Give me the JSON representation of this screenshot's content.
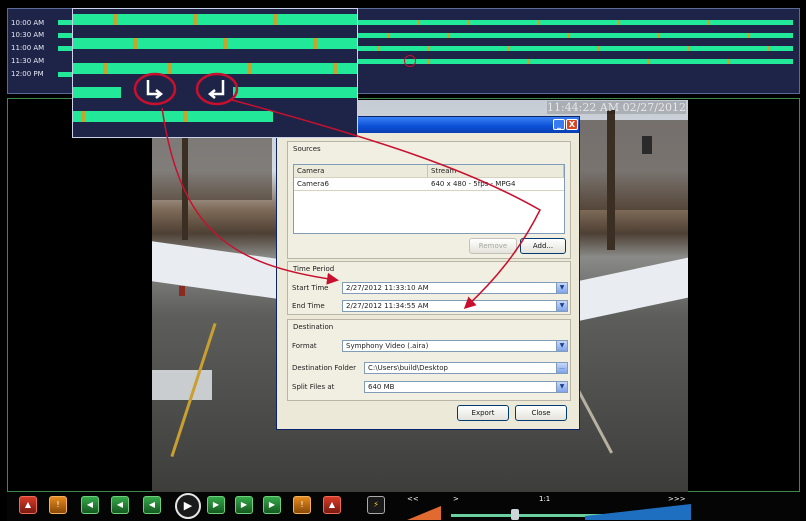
{
  "timeline": {
    "labels": [
      "10:00 AM",
      "10:30 AM",
      "11:00 AM",
      "11:30 AM",
      "12:00 PM"
    ]
  },
  "video": {
    "timestamp": "11:44:22 AM 02/27/2012"
  },
  "dialog": {
    "titlebar_buttons": {
      "minimize": "_",
      "close": "X"
    },
    "sources": {
      "group_label": "Sources",
      "columns": [
        "Camera",
        "Stream"
      ],
      "rows": [
        {
          "camera": "Camera6",
          "stream": "640 x 480 - 5fps - MPG4"
        }
      ],
      "remove_label": "Remove",
      "add_label": "Add..."
    },
    "time_period": {
      "group_label": "Time Period",
      "start_label": "Start Time",
      "start_value": "2/27/2012 11:33:10 AM",
      "end_label": "End Time",
      "end_value": "2/27/2012 11:34:55 AM"
    },
    "destination": {
      "group_label": "Destination",
      "format_label": "Format",
      "format_value": "Symphony Video (.aira)",
      "folder_label": "Destination Folder",
      "folder_value": "C:\\Users\\build\\Desktop",
      "browse_label": "...",
      "split_label": "Split Files at",
      "split_value": "640 MB"
    },
    "export_label": "Export",
    "close_label": "Close"
  },
  "controls": {
    "speed_labels": {
      "slow": "<<",
      "reverse": ">",
      "normal": "1:1",
      "fast": ">>>"
    }
  },
  "colors": {
    "timeline_bg": "#1e2448",
    "recording_green": "#22e89a",
    "motion_orange": "#c9a42a",
    "annotation_red": "#c8102e",
    "xp_title_blue": "#0a4fd6",
    "dialog_face": "#ece9d8"
  },
  "icons": [
    "start-marker-icon",
    "end-marker-icon",
    "play-icon",
    "export-icon"
  ]
}
